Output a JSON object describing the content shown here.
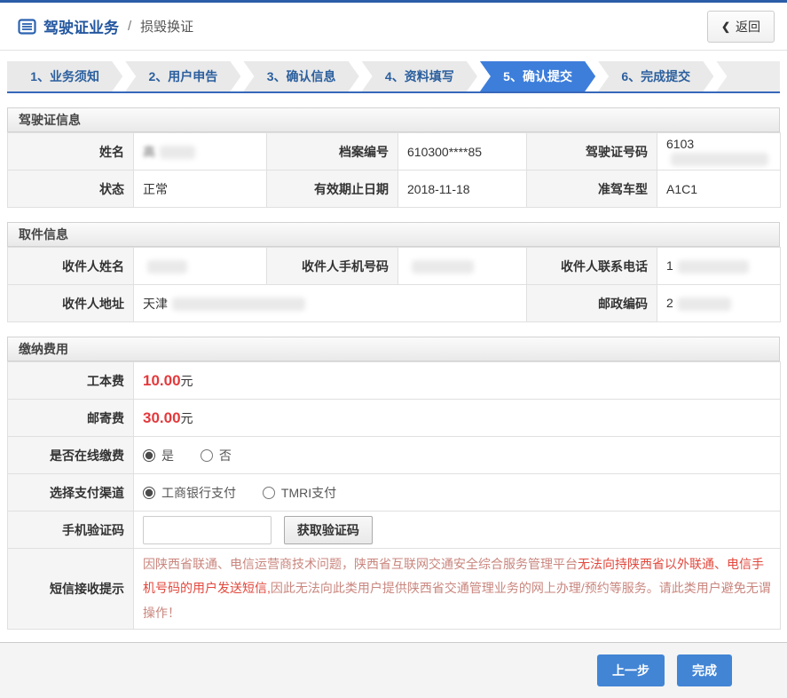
{
  "colors": {
    "accent_blue": "#3d7edb",
    "topline_blue": "#2b5da8",
    "price_red": "#e4393c",
    "step_text_blue": "#2b5f9e"
  },
  "header": {
    "title": "驾驶证业务",
    "separator": "/",
    "subtitle": "损毁换证",
    "back": {
      "icon": "❮",
      "label": "返回"
    }
  },
  "steps": {
    "items": [
      {
        "label": "1、业务须知",
        "active": false
      },
      {
        "label": "2、用户申告",
        "active": false
      },
      {
        "label": "3、确认信息",
        "active": false
      },
      {
        "label": "4、资料填写",
        "active": false
      },
      {
        "label": "5、确认提交",
        "active": true
      },
      {
        "label": "6、完成提交",
        "active": false
      }
    ]
  },
  "license": {
    "title": "驾驶证信息",
    "rows": [
      [
        {
          "label": "姓名",
          "value": "高",
          "masked": true
        },
        {
          "label": "档案编号",
          "value": "610300****85"
        },
        {
          "label": "驾驶证号码",
          "value": "6103",
          "masked": true
        }
      ],
      [
        {
          "label": "状态",
          "value": "正常"
        },
        {
          "label": "有效期止日期",
          "value": "2018-11-18"
        },
        {
          "label": "准驾车型",
          "value": "A1C1"
        }
      ]
    ]
  },
  "pickup": {
    "title": "取件信息",
    "row1": [
      {
        "label": "收件人姓名",
        "value": "",
        "masked": true
      },
      {
        "label": "收件人手机号码",
        "value": "",
        "masked": true
      },
      {
        "label": "收件人联系电话",
        "value": "1",
        "masked": true
      }
    ],
    "address": {
      "label": "收件人地址",
      "value": "天津",
      "masked": true
    },
    "postal": {
      "label": "邮政编码",
      "value": "2",
      "masked": true
    }
  },
  "fees": {
    "title": "缴纳费用",
    "work_fee": {
      "label": "工本费",
      "amount": "10.00",
      "unit": "元"
    },
    "mail_fee": {
      "label": "邮寄费",
      "amount": "30.00",
      "unit": "元"
    },
    "online": {
      "label": "是否在线缴费",
      "options": [
        {
          "label": "是",
          "checked": "checked"
        },
        {
          "label": "否"
        }
      ]
    },
    "channel": {
      "label": "选择支付渠道",
      "options": [
        {
          "label": "工商银行支付",
          "checked": "checked"
        },
        {
          "label": "TMRI支付"
        }
      ]
    },
    "code": {
      "label": "手机验证码",
      "value": "",
      "button_label": "获取验证码"
    },
    "notice": {
      "label": "短信接收提示",
      "prefix": "因陕西省联通、电信运营商技术问题，陕西省互联网交通安全综合服务管理平台",
      "emphasis": "无法向持陕西省以外联通、电信手机号码的用户发送短信,",
      "suffix": "因此无法向此类用户提供陕西省交通管理业务的网上办理/预约等服务。请此类用户避免无谓操作！"
    }
  },
  "footer": {
    "prev_label": "上一步",
    "finish_label": "完成"
  }
}
